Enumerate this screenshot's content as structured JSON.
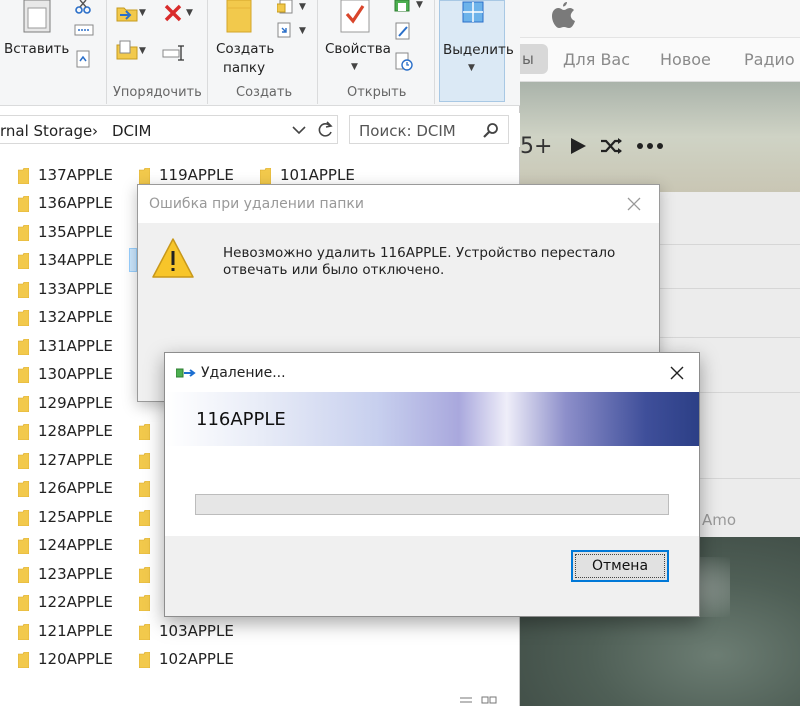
{
  "explorer": {
    "ribbon": {
      "paste_label": "Вставить",
      "group_organize": "Упорядочить",
      "new_folder_label_1": "Создать",
      "new_folder_label_2": "папку",
      "group_create": "Создать",
      "properties_label": "Свойства",
      "group_open": "Открыть",
      "select_label": "Выделить"
    },
    "address": {
      "path_part_1": "rnal Storage",
      "separator": "›",
      "path_part_2": "DCIM"
    },
    "search": {
      "placeholder": "Поиск: DCIM"
    },
    "folders": {
      "col1": [
        "137APPLE",
        "136APPLE",
        "135APPLE",
        "134APPLE",
        "133APPLE",
        "132APPLE",
        "131APPLE",
        "130APPLE",
        "129APPLE",
        "128APPLE",
        "127APPLE",
        "126APPLE",
        "125APPLE",
        "124APPLE",
        "123APPLE",
        "122APPLE",
        "121APPLE",
        "120APPLE"
      ],
      "col2_top": "119APPLE",
      "col2_bottom": [
        "103APPLE",
        "102APPLE"
      ],
      "col3_top": "101APPLE"
    }
  },
  "error_dialog": {
    "title": "Ошибка при удалении папки",
    "message_line1": "Невозможно удалить 116APPLE. Устройство перестало",
    "message_line2": "отвечать или было отключено."
  },
  "delete_dialog": {
    "title": "Удаление...",
    "item_name": "116APPLE",
    "progress": 0,
    "cancel_label": "Отмена"
  },
  "music_app": {
    "tab_partial": "ы",
    "tabs": [
      "Для Вас",
      "Новое",
      "Радио"
    ],
    "play_count_partial": "5+",
    "partial_text": "Amo"
  }
}
